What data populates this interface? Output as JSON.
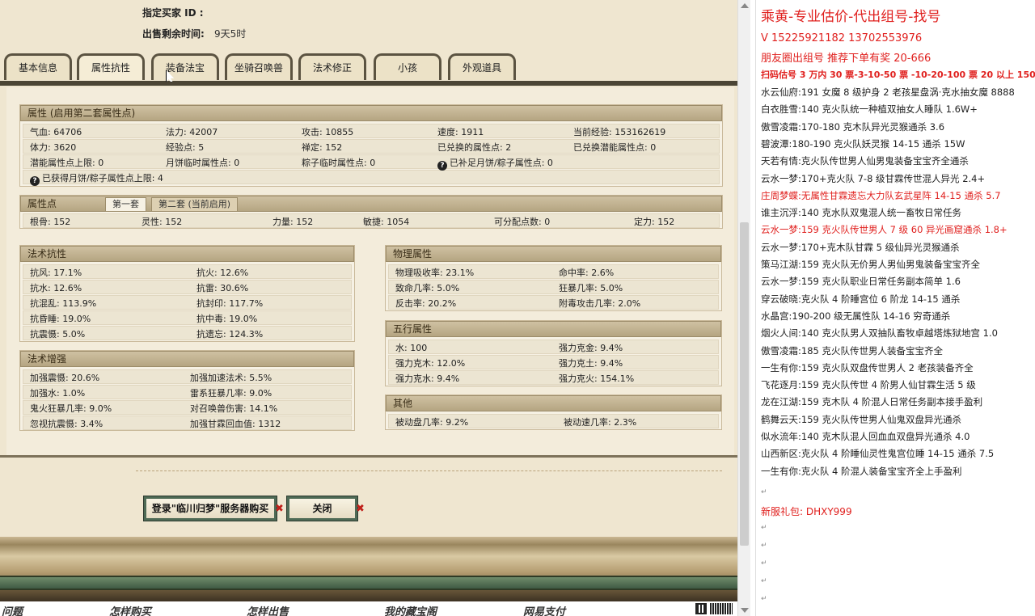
{
  "seller": {
    "designated_buyer_label": "指定买家 ID :",
    "time_left_label": "出售剩余时间:",
    "time_left_value": "9天5时"
  },
  "tabs": [
    "基本信息",
    "属性抗性",
    "装备法宝",
    "坐骑召唤兽",
    "法术修正",
    "小孩",
    "外观道具"
  ],
  "attr_panel": {
    "title": "属性 (启用第二套属性点)",
    "rows": [
      [
        [
          "气血: 64706"
        ],
        [
          "法力: 42007"
        ],
        [
          "攻击: 10855"
        ],
        [
          "速度: 1911"
        ],
        [
          "当前经验: 153162619"
        ]
      ],
      [
        [
          "体力: 3620"
        ],
        [
          "经验点: 5"
        ],
        [
          "禅定: 152"
        ],
        [
          "已兑换的属性点: 2"
        ],
        [
          "已兑换潜能属性点: 0"
        ]
      ],
      [
        [
          "潜能属性点上限: 0"
        ],
        [
          "月饼临时属性点: 0"
        ],
        [
          "粽子临时属性点: 0"
        ],
        [
          "已补足月饼/粽子属性点: 0"
        ]
      ],
      [
        [
          "已获得月饼/粽子属性点上限: 4"
        ]
      ]
    ]
  },
  "points_panel": {
    "title": "属性点",
    "subtab1": "第一套",
    "subtab2": "第二套 (当前启用)",
    "values": [
      "根骨: 152",
      "灵性: 152",
      "力量: 152",
      "敏捷: 1054",
      "可分配点数: 0",
      "定力: 152"
    ]
  },
  "spell_resist": {
    "title": "法术抗性",
    "left": [
      "抗风: 17.1%",
      "抗水: 12.6%",
      "抗混乱: 113.9%",
      "抗昏睡: 19.0%",
      "抗震慑: 5.0%"
    ],
    "right": [
      "抗火: 12.6%",
      "抗雷: 30.6%",
      "抗封印: 117.7%",
      "抗中毒: 19.0%",
      "抗遗忘: 124.3%"
    ]
  },
  "spell_boost": {
    "title": "法术增强",
    "left": [
      "加强震慑: 20.6%",
      "加强水: 1.0%",
      "鬼火狂暴几率: 9.0%",
      "忽视抗震慑: 3.4%"
    ],
    "right": [
      "加强加速法术: 5.5%",
      "雷系狂暴几率: 9.0%",
      "对召唤兽伤害: 14.1%",
      "加强甘霖回血值: 1312"
    ]
  },
  "physical": {
    "title": "物理属性",
    "left": [
      "物理吸收率: 23.1%",
      "致命几率: 5.0%",
      "反击率: 20.2%"
    ],
    "right": [
      "命中率: 2.6%",
      "狂暴几率: 5.0%",
      "附毒攻击几率: 2.0%"
    ]
  },
  "five_elements": {
    "title": "五行属性",
    "left": [
      "水: 100",
      "强力克木: 12.0%",
      "强力克水: 9.4%"
    ],
    "right": [
      "强力克金: 9.4%",
      "强力克土: 9.4%",
      "强力克火: 154.1%"
    ]
  },
  "other": {
    "title": "其他",
    "left": "被动盘几率: 9.2%",
    "right": "被动速几率: 2.3%"
  },
  "buttons": {
    "login_buy": "登录\"临川归梦\"服务器购买",
    "close": "关闭"
  },
  "footer_links": [
    "问题",
    "怎样购买",
    "怎样出售",
    "我的藏宝阁",
    "网易支付"
  ],
  "notepad": {
    "title": "乘黄-专业估价-代出组号-找号",
    "phone": "V   15225921182   13702553976",
    "line3": "朋友圈出组号  推荐下单有奖 20-666",
    "line4": "扫码估号 3 万内 30 票-3-10-50 票  -10-20-100 票  20 以上 150",
    "lines": [
      {
        "t": "水云仙府:191 女魔 8 级护身 2 老孩星盘涡·克水抽女魔 8888",
        "red": false
      },
      {
        "t": "白衣胜雪:140 克火队统一种植双抽女人睡队 1.6W+",
        "red": false
      },
      {
        "t": "傲雪凌霜:170-180 克木队异光灵猴通杀 3.6",
        "red": false
      },
      {
        "t": "碧波潭:180-190 克火队妖灵猴 14-15 通杀 15W",
        "red": false
      },
      {
        "t": "天若有情:克火队传世男人仙男鬼装备宝宝齐全通杀",
        "red": false
      },
      {
        "t": "云水一梦:170+克火队 7-8 级甘霖传世混人异光 2.4+",
        "red": false
      },
      {
        "t": "庄周梦蝶:无属性甘霖遗忘大力队玄武星阵 14-15 通杀 5.7",
        "red": true
      },
      {
        "t": "谁主沉浮:140 克水队双鬼混人统一畜牧日常任务",
        "red": false
      },
      {
        "t": "云水一梦:159 克火队传世男人 7 级 60 异光画窟通杀 1.8+",
        "red": true
      },
      {
        "t": "云水一梦:170+克木队甘霖 5 级仙异光灵猴通杀",
        "red": false
      },
      {
        "t": "策马江湖:159 克火队无价男人男仙男鬼装备宝宝齐全",
        "red": false
      },
      {
        "t": "云水一梦:159 克火队职业日常任务副本简单 1.6",
        "red": false
      },
      {
        "t": "穿云破晓:克火队 4 阶睡宫位 6 阶龙 14-15 通杀",
        "red": false
      },
      {
        "t": "水晶宫:190-200 级无属性队 14-16 穷奇通杀",
        "red": false
      },
      {
        "t": "烟火人间:140 克火队男人双抽队畜牧卓越塔炼狱地宫 1.0",
        "red": false
      },
      {
        "t": "傲雪凌霜:185 克火队传世男人装备宝宝齐全",
        "red": false
      },
      {
        "t": "一生有你:159 克火队双盘传世男人 2 老孩装备齐全",
        "red": false
      },
      {
        "t": "飞花逐月:159 克火队传世 4 阶男人仙甘霖生活 5 级",
        "red": false
      },
      {
        "t": "龙在江湖:159 克木队 4 阶混人日常任务副本接手盈利",
        "red": false
      },
      {
        "t": "鹤舞云天:159 克火队传世男人仙鬼双盘异光通杀",
        "red": false
      },
      {
        "t": "似水流年:140 克木队混人回血血双盘异光通杀 4.0",
        "red": false
      },
      {
        "t": "山西新区:克火队 4 阶睡仙灵性鬼宫位睡 14-15 通杀 7.5",
        "red": false
      },
      {
        "t": "一生有你:克火队 4 阶混人装备宝宝齐全上手盈利",
        "red": false
      }
    ],
    "gift": "新服礼包: DHXY999"
  }
}
